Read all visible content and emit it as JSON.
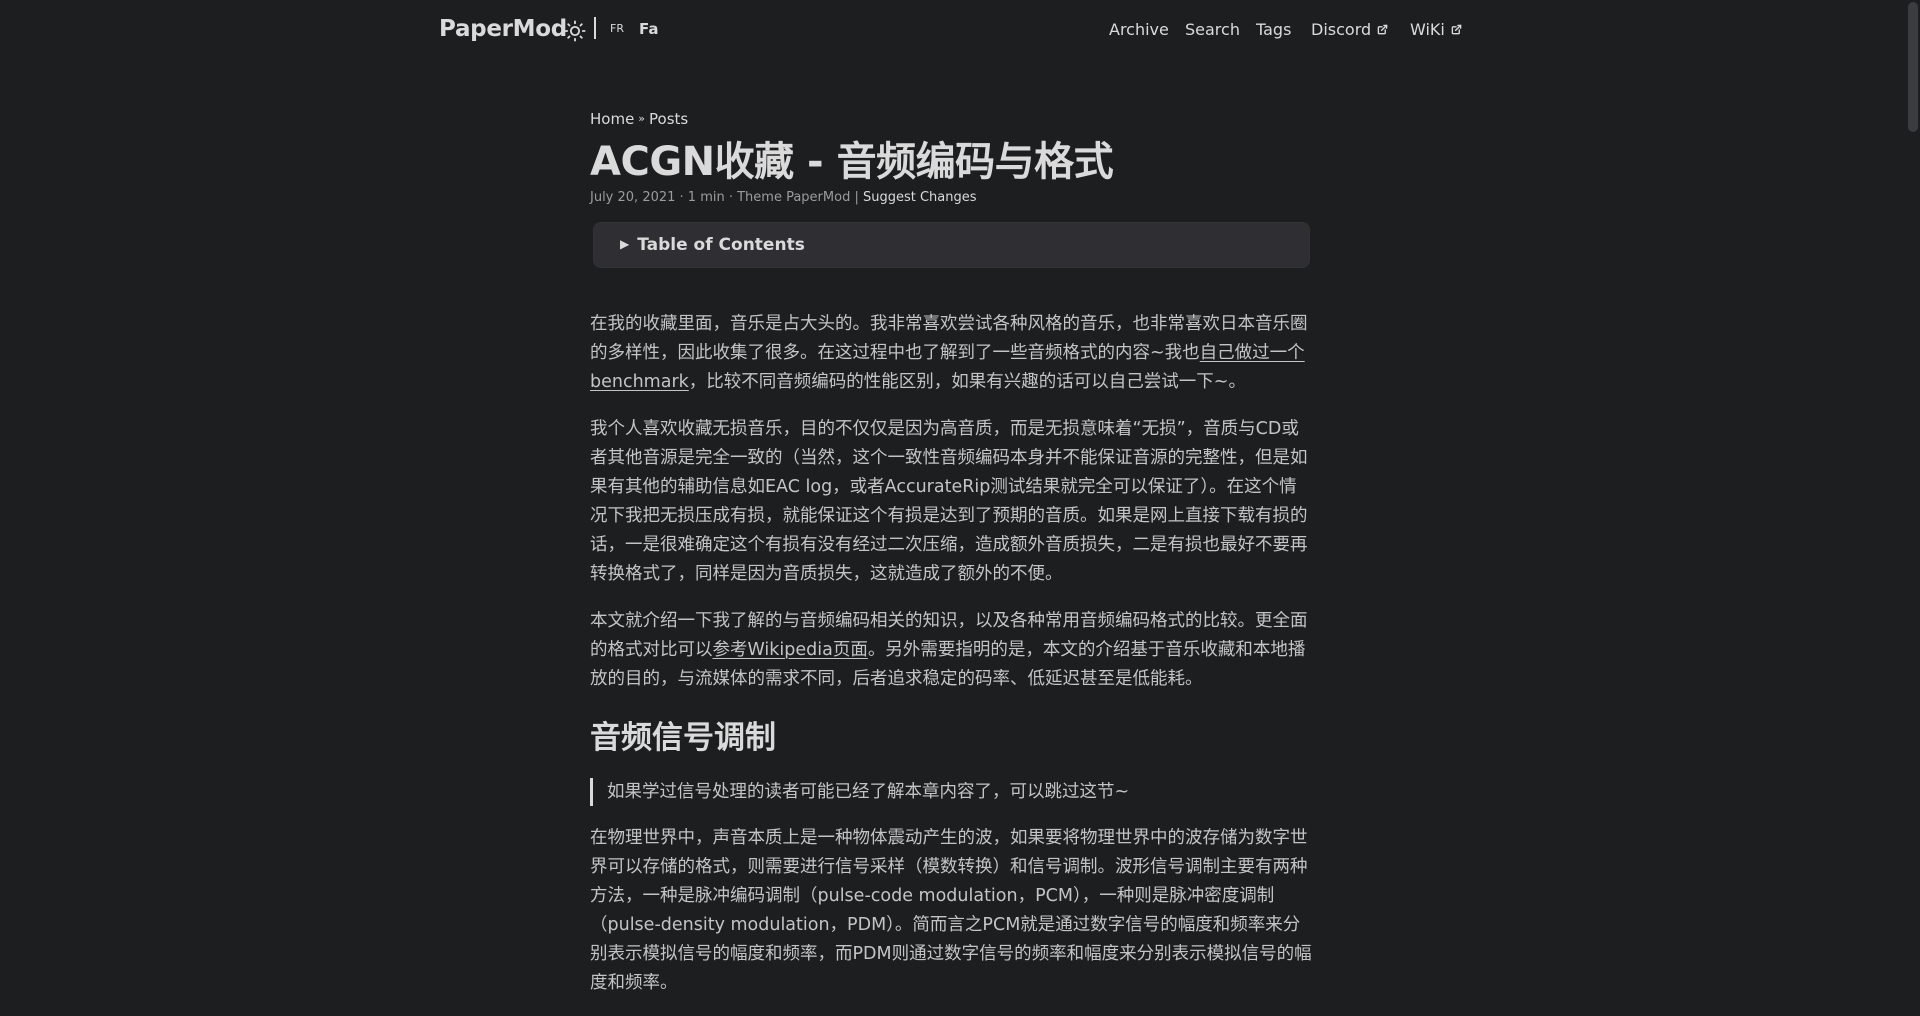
{
  "header": {
    "logo": "PaperMod",
    "lang_fr": "FR",
    "lang_fa": "Fa",
    "nav": [
      {
        "label": "Archive"
      },
      {
        "label": "Search"
      },
      {
        "label": "Tags"
      },
      {
        "label": "Discord"
      },
      {
        "label": "WiKi"
      }
    ]
  },
  "breadcrumb": {
    "home": "Home",
    "sep": "»",
    "posts": "Posts"
  },
  "post": {
    "title": "ACGN收藏 - 音频编码与格式",
    "meta": "July 20, 2021 · 1 min · Theme PaperMod | ",
    "suggest": "Suggest Changes"
  },
  "toc": {
    "label": "Table of Contents"
  },
  "content": {
    "p1_a": "在我的收藏里面，音乐是占大头的。我非常喜欢尝试各种风格的音乐，也非常喜欢日本音乐圈的多样性，因此收集了很多。在这过程中也了解到了一些音频格式的内容~我也",
    "p1_link": "自己做过一个benchmark",
    "p1_b": "，比较不同音频编码的性能区别，如果有兴趣的话可以自己尝试一下~。",
    "p2": "我个人喜欢收藏无损音乐，目的不仅仅是因为高音质，而是无损意味着“无损”，音质与CD或者其他音源是完全一致的（当然，这个一致性音频编码本身并不能保证音源的完整性，但是如果有其他的辅助信息如EAC log，或者AccurateRip测试结果就完全可以保证了）。在这个情况下我把无损压成有损，就能保证这个有损是达到了预期的音质。如果是网上直接下载有损的话，一是很难确定这个有损有没有经过二次压缩，造成额外音质损失，二是有损也最好不要再转换格式了，同样是因为音质损失，这就造成了额外的不便。",
    "p3_a": "本文就介绍一下我了解的与音频编码相关的知识，以及各种常用音频编码格式的比较。更全面的格式对比可以",
    "p3_link": "参考Wikipedia页面",
    "p3_b": "。另外需要指明的是，本文的介绍基于音乐收藏和本地播放的目的，与流媒体的需求不同，后者追求稳定的码率、低延迟甚至是低能耗。",
    "h2": "音频信号调制",
    "quote": "如果学过信号处理的读者可能已经了解本章内容了，可以跳过这节~",
    "p4": "在物理世界中，声音本质上是一种物体震动产生的波，如果要将物理世界中的波存储为数字世界可以存储的格式，则需要进行信号采样（模数转换）和信号调制。波形信号调制主要有两种方法，一种是脉冲编码调制（pulse-code modulation，PCM），一种则是脉冲密度调制（pulse-density modulation，PDM）。简而言之PCM就是通过数字信号的幅度和频率来分别表示模拟信号的幅度和频率，而PDM则通过数字信号的频率和幅度来分别表示模拟信号的幅度和频率。"
  },
  "colors": {
    "background": "#1d1e20",
    "text": "#dadadb",
    "toc_bg": "#2e2e33"
  }
}
